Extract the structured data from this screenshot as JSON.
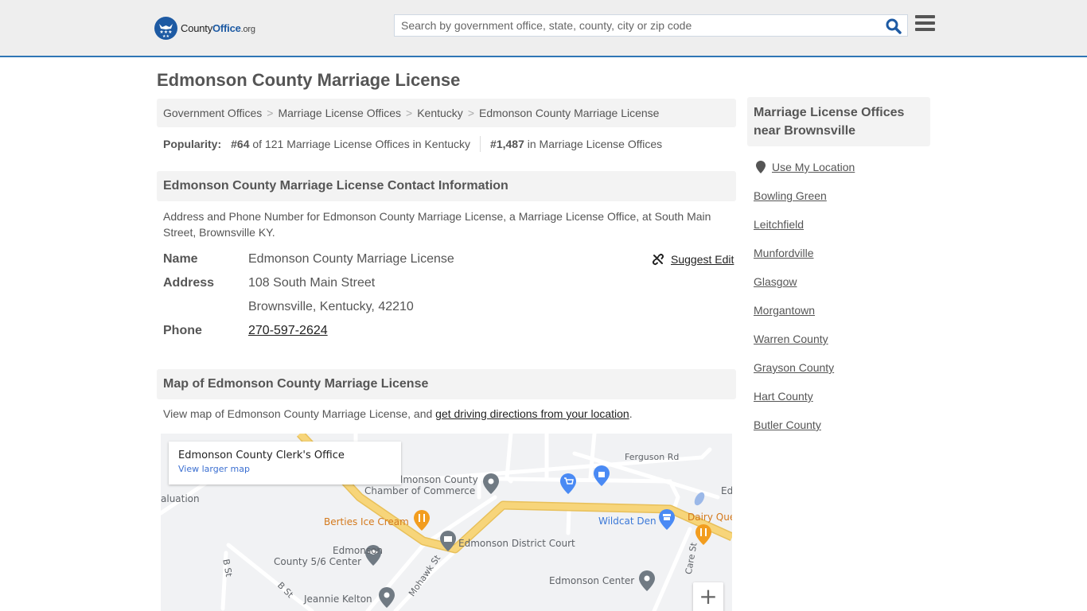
{
  "header": {
    "logo": {
      "county": "County",
      "office": "Office",
      "org": ".org"
    },
    "search_placeholder": "Search by government office, state, county, city or zip code",
    "search_icon": "search-icon",
    "menu_icon": "hamburger-menu-icon"
  },
  "page_title": "Edmonson County Marriage License",
  "breadcrumb": [
    "Government Offices",
    "Marriage License Offices",
    "Kentucky",
    "Edmonson County Marriage License"
  ],
  "breadcrumb_separator": ">",
  "popularity": {
    "label": "Popularity:",
    "state_rank": "#64",
    "state_rank_text": "of 121 Marriage License Offices in Kentucky",
    "national_rank": "#1,487",
    "national_rank_text": "in Marriage License Offices"
  },
  "contact": {
    "heading": "Edmonson County Marriage License Contact Information",
    "description": "Address and Phone Number for Edmonson County Marriage License, a Marriage License Office, at South Main Street, Brownsville KY.",
    "suggest_edit": "Suggest Edit",
    "rows": {
      "name_label": "Name",
      "name_value": "Edmonson County Marriage License",
      "address_label": "Address",
      "address_line1": "108 South Main Street",
      "address_line2": "Brownsville, Kentucky, 42210",
      "phone_label": "Phone",
      "phone_value": "270-597-2624"
    }
  },
  "map_section": {
    "heading": "Map of Edmonson County Marriage License",
    "description": "View map of Edmonson County Marriage License, and ",
    "directions_link": "get driving directions from your location",
    "description_end": ".",
    "card_title": "Edmonson County Clerk's Office",
    "card_link": "View larger map",
    "zoom_in": "+",
    "labels": {
      "evaluation": "aluation",
      "chamber1": "lmonson County",
      "chamber2": "Chamber of Commerce",
      "berties": "Berties Ice Cream",
      "district_court": "Edmonson District Court",
      "center56_1": "Edmonson",
      "center56_2": "County 5/6 Center",
      "jeannie": "Jeannie Kelton",
      "ferguson": "Ferguson Rd",
      "wildcat": "Wildcat Den",
      "dairy": "Dairy Que",
      "edmonson_center": "Edmonson Center",
      "ed": "Ed",
      "mohawk": "Mohawk St",
      "bst1": "B St",
      "bst2": "B St",
      "care": "Care St"
    }
  },
  "sidebar": {
    "heading": "Marriage License Offices near Brownsville",
    "use_location": "Use My Location",
    "links": [
      "Bowling Green",
      "Leitchfield",
      "Munfordville",
      "Glasgow",
      "Morgantown",
      "Warren County",
      "Grayson County",
      "Hart County",
      "Butler County"
    ]
  },
  "colors": {
    "brand_blue": "#1d5aa3",
    "header_border": "#2f76b5",
    "header_bg": "#eeeeee",
    "panel_bg": "#f3f3f3",
    "text": "#555555",
    "map_road_highway": "#f7d57a",
    "map_orange": "#d4791c",
    "map_blue": "#3a78d8"
  }
}
